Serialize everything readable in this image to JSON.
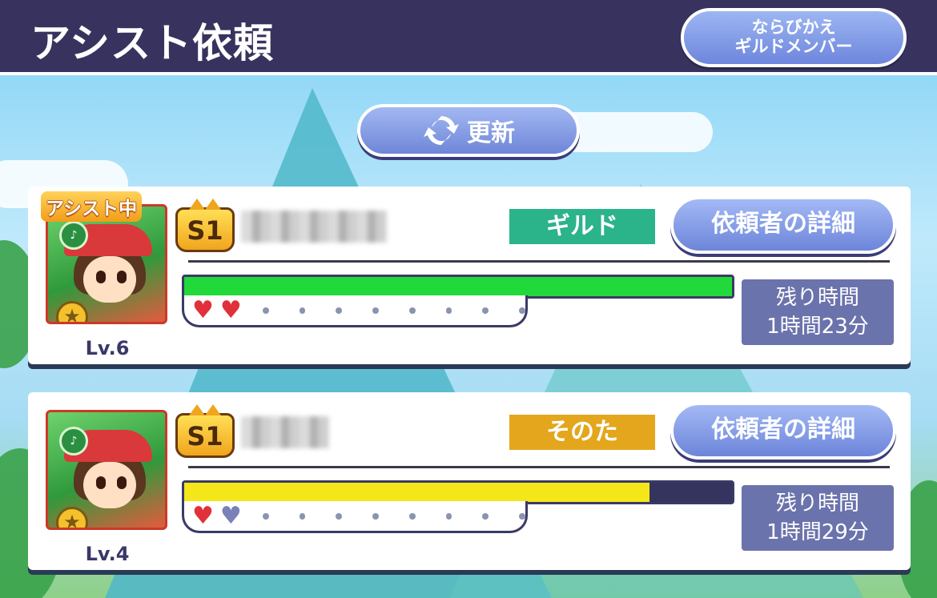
{
  "header": {
    "title": "アシスト依頼",
    "sort_button": {
      "line1": "ならびかえ",
      "line2": "ギルドメンバー"
    }
  },
  "refresh_button": {
    "label": "更新",
    "icon": "refresh-icon"
  },
  "requests": [
    {
      "assisting_label": "アシスト中",
      "level": "Lv.6",
      "rank": "S1",
      "category": "ギルド",
      "category_color": "#2bb38a",
      "detail_button": "依頼者の詳細",
      "gauge_fill_percent": 100,
      "gauge_color": "#21d93b",
      "hearts": [
        "full",
        "full"
      ],
      "time_label": "残り時間",
      "time_value": "1時間23分"
    },
    {
      "level": "Lv.4",
      "rank": "S1",
      "category": "そのた",
      "category_color": "#e3a61c",
      "detail_button": "依頼者の詳細",
      "gauge_fill_percent": 85,
      "gauge_color": "#f5e61a",
      "hearts": [
        "full",
        "empty"
      ],
      "time_label": "残り時間",
      "time_value": "1時間29分"
    }
  ]
}
